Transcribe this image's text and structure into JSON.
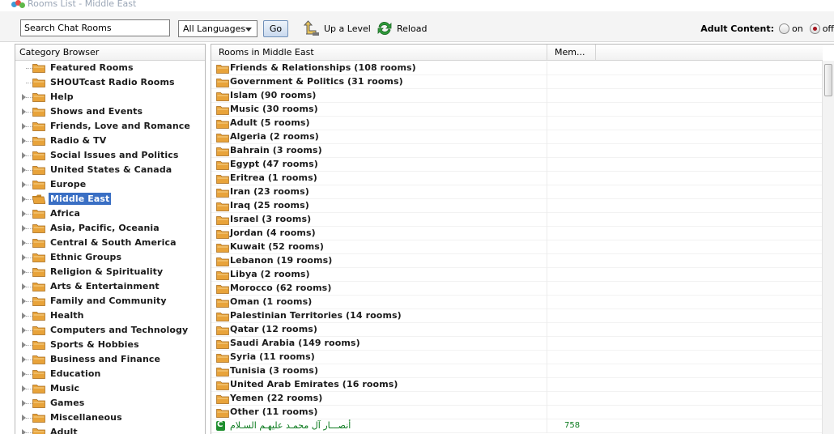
{
  "window": {
    "title": "Rooms List - Middle East"
  },
  "toolbar": {
    "search_value": "Search Chat Rooms",
    "language_selected": "All Languages",
    "go_label": "Go",
    "up_level_label": "Up a Level",
    "reload_label": "Reload",
    "adult_label": "Adult Content:",
    "adult_on_label": "on",
    "adult_off_label": "off",
    "adult_selected": "off"
  },
  "category_browser": {
    "header": "Category Browser",
    "selected": "Middle East",
    "items": [
      {
        "label": "Featured Rooms",
        "expandable": false
      },
      {
        "label": "SHOUTcast Radio Rooms",
        "expandable": false
      },
      {
        "label": "Help",
        "expandable": true
      },
      {
        "label": "Shows and Events",
        "expandable": true
      },
      {
        "label": "Friends, Love and Romance",
        "expandable": true
      },
      {
        "label": "Radio & TV",
        "expandable": true
      },
      {
        "label": "Social Issues and Politics",
        "expandable": true
      },
      {
        "label": "United States & Canada",
        "expandable": true
      },
      {
        "label": "Europe",
        "expandable": true
      },
      {
        "label": "Middle East",
        "expandable": true
      },
      {
        "label": "Africa",
        "expandable": true
      },
      {
        "label": "Asia, Pacific, Oceania",
        "expandable": true
      },
      {
        "label": "Central & South America",
        "expandable": true
      },
      {
        "label": "Ethnic Groups",
        "expandable": true
      },
      {
        "label": "Religion & Spirituality",
        "expandable": true
      },
      {
        "label": "Arts & Entertainment",
        "expandable": true
      },
      {
        "label": "Family and Community",
        "expandable": true
      },
      {
        "label": "Health",
        "expandable": true
      },
      {
        "label": "Computers and Technology",
        "expandable": true
      },
      {
        "label": "Sports & Hobbies",
        "expandable": true
      },
      {
        "label": "Business and Finance",
        "expandable": true
      },
      {
        "label": "Education",
        "expandable": true
      },
      {
        "label": "Music",
        "expandable": true
      },
      {
        "label": "Games",
        "expandable": true
      },
      {
        "label": "Miscellaneous",
        "expandable": true
      },
      {
        "label": "Adult",
        "expandable": true
      }
    ]
  },
  "room_list": {
    "columns": [
      "Rooms in Middle East",
      "Mem..."
    ],
    "categories": [
      "Friends & Relationships (108 rooms)",
      "Government & Politics (31 rooms)",
      "Islam (90 rooms)",
      "Music (30 rooms)",
      "Adult (5 rooms)",
      "Algeria (2 rooms)",
      "Bahrain (3 rooms)",
      "Egypt (47 rooms)",
      "Eritrea (1 rooms)",
      "Iran (23 rooms)",
      "Iraq (25 rooms)",
      "Israel (3 rooms)",
      "Jordan (4 rooms)",
      "Kuwait (52 rooms)",
      "Lebanon (19 rooms)",
      "Libya (2 rooms)",
      "Morocco (62 rooms)",
      "Oman (1 rooms)",
      "Palestinian Territories (14 rooms)",
      "Qatar (12 rooms)",
      "Saudi Arabia (149 rooms)",
      "Syria (11 rooms)",
      "Tunisia (3 rooms)",
      "United Arab Emirates (16 rooms)",
      "Yemen (22 rooms)",
      "Other (11 rooms)"
    ],
    "rooms": [
      {
        "name": "أنصـــار آل محمـد عليهـم السـلام",
        "members": "758"
      }
    ]
  },
  "colors": {
    "selection": "#3a6fc4",
    "room_text": "#0b7a1e",
    "folder": "#e8a33a"
  }
}
